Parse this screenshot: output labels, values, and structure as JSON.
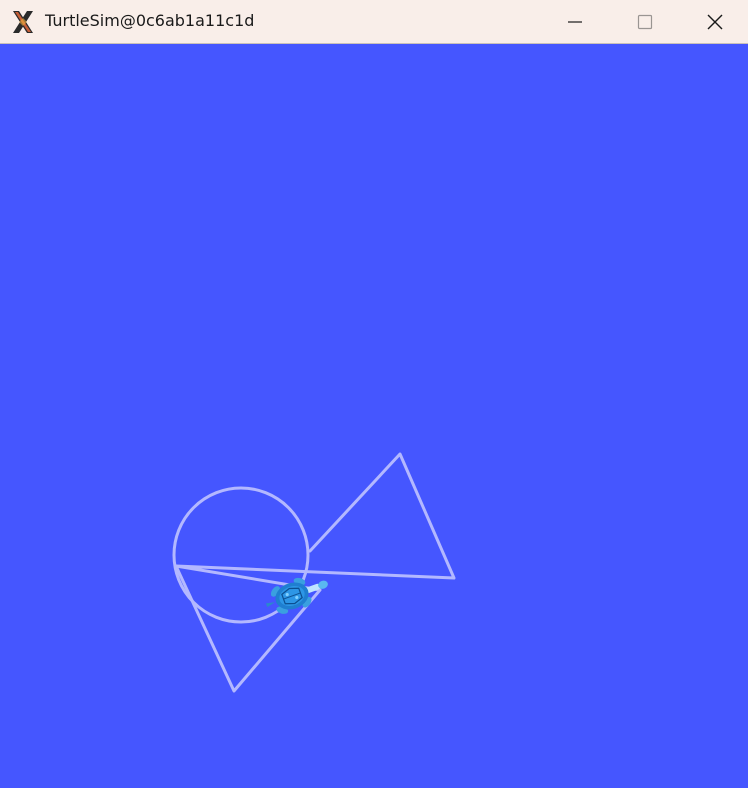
{
  "window": {
    "title": "TurtleSim@0c6ab1a11c1d",
    "background_color": "#4556ff",
    "titlebar_color": "#f9eee9"
  },
  "titlebar": {
    "app_icon": "x-server-icon",
    "buttons": [
      {
        "name": "minimize-icon"
      },
      {
        "name": "maximize-icon"
      },
      {
        "name": "close-icon"
      }
    ]
  },
  "canvas": {
    "pen_color": "#b3b8ff",
    "turtle_icon": "turtle-icon"
  }
}
